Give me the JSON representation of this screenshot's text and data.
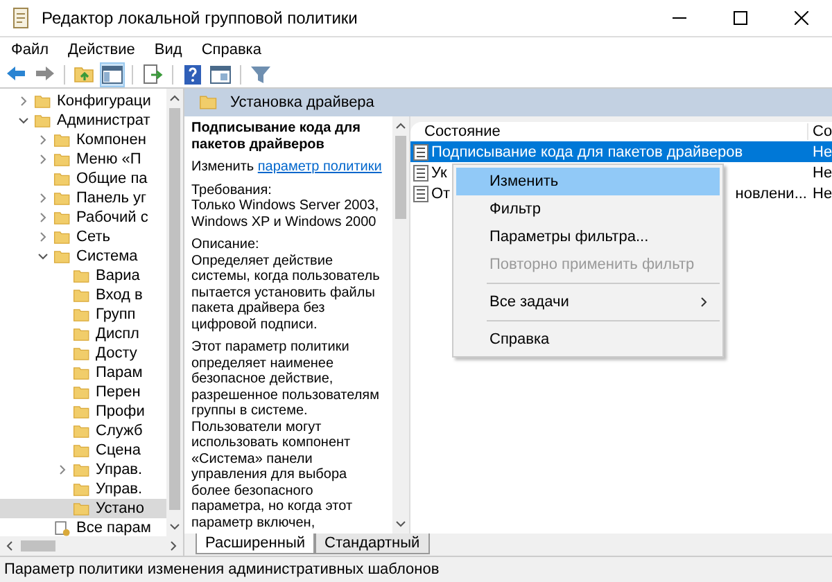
{
  "window": {
    "title": "Редактор локальной групповой политики"
  },
  "menu": [
    "Файл",
    "Действие",
    "Вид",
    "Справка"
  ],
  "toolbar": [
    {
      "kind": "back"
    },
    {
      "kind": "forward"
    },
    {
      "kind": "separator"
    },
    {
      "kind": "up"
    },
    {
      "kind": "tree",
      "selected": true
    },
    {
      "kind": "separator"
    },
    {
      "kind": "export"
    },
    {
      "kind": "separator"
    },
    {
      "kind": "help"
    },
    {
      "kind": "view"
    },
    {
      "kind": "separator"
    },
    {
      "kind": "filter"
    }
  ],
  "tree": [
    {
      "label": "Конфигураци",
      "expanded": false,
      "selected": false
    },
    {
      "label": "Администрат",
      "expanded": true,
      "selected": false,
      "children": [
        {
          "label": "Компонен",
          "expanded": false,
          "selected": false
        },
        {
          "label": "Меню «П",
          "expanded": false,
          "selected": false
        },
        {
          "label": "Общие па",
          "selected": false
        },
        {
          "label": "Панель уг",
          "expanded": false,
          "selected": false
        },
        {
          "label": "Рабочий с",
          "expanded": false,
          "selected": false
        },
        {
          "label": "Сеть",
          "expanded": false,
          "selected": false
        },
        {
          "label": "Система",
          "expanded": true,
          "selected": false,
          "children": [
            {
              "label": "Вариа",
              "selected": false
            },
            {
              "label": "Вход в",
              "selected": false
            },
            {
              "label": "Групп",
              "selected": false
            },
            {
              "label": "Диспл",
              "selected": false
            },
            {
              "label": "Досту",
              "selected": false
            },
            {
              "label": "Парам",
              "selected": false
            },
            {
              "label": "Перен",
              "selected": false
            },
            {
              "label": "Профи",
              "selected": false
            },
            {
              "label": "Служб",
              "selected": false
            },
            {
              "label": "Сцена",
              "selected": false
            },
            {
              "label": "Управ.",
              "expanded": false,
              "selected": false
            },
            {
              "label": "Управ.",
              "selected": false
            },
            {
              "label": "Устано",
              "selected": true
            }
          ]
        },
        {
          "label": "Все парам",
          "kind": "settings",
          "selected": false
        }
      ]
    }
  ],
  "header": {
    "title": "Установка драйвера"
  },
  "description": {
    "title": "Подписывание кода для пакетов драйверов",
    "edit_text": "Изменить",
    "edit_link": "параметр политики",
    "requirements_label": "Требования:",
    "requirements": "Только Windows Server 2003, Windows XP и Windows 2000",
    "description_label": "Описание:",
    "description": "Определяет действие системы, когда пользователь пытается установить файлы пакета драйвера без цифровой подписи.",
    "details": "Этот параметр политики определяет наименее безопасное действие, разрешенное пользователям группы в системе. Пользователи могут использовать компонент «Система» панели управления для выбора более безопасного параметра, но когда этот параметр включен,"
  },
  "list": {
    "columns": [
      "Состояние",
      "Со"
    ],
    "rows": [
      {
        "name": "Подписывание кода для пакетов драйверов",
        "state": "Не",
        "selected": true
      },
      {
        "name": "Ук",
        "state": "Не",
        "selected": false
      },
      {
        "name": "От",
        "name_tail": "новлени...",
        "state": "Не",
        "selected": false
      }
    ]
  },
  "context_menu": [
    {
      "kind": "item",
      "label": "Изменить",
      "selected": true,
      "disabled": false
    },
    {
      "kind": "item",
      "label": "Фильтр",
      "selected": false,
      "disabled": false
    },
    {
      "kind": "item",
      "label": "Параметры фильтра...",
      "selected": false,
      "disabled": false
    },
    {
      "kind": "item",
      "label": "Повторно применить фильтр",
      "selected": false,
      "disabled": true
    },
    {
      "kind": "separator"
    },
    {
      "kind": "submenu",
      "label": "Все задачи",
      "selected": false,
      "disabled": false
    },
    {
      "kind": "separator"
    },
    {
      "kind": "item",
      "label": "Справка",
      "selected": false,
      "disabled": false
    }
  ],
  "tabs": [
    {
      "label": "Расширенный",
      "selected": true
    },
    {
      "label": "Стандартный",
      "selected": false
    }
  ],
  "status_bar": "Параметр политики изменения административных шаблонов"
}
